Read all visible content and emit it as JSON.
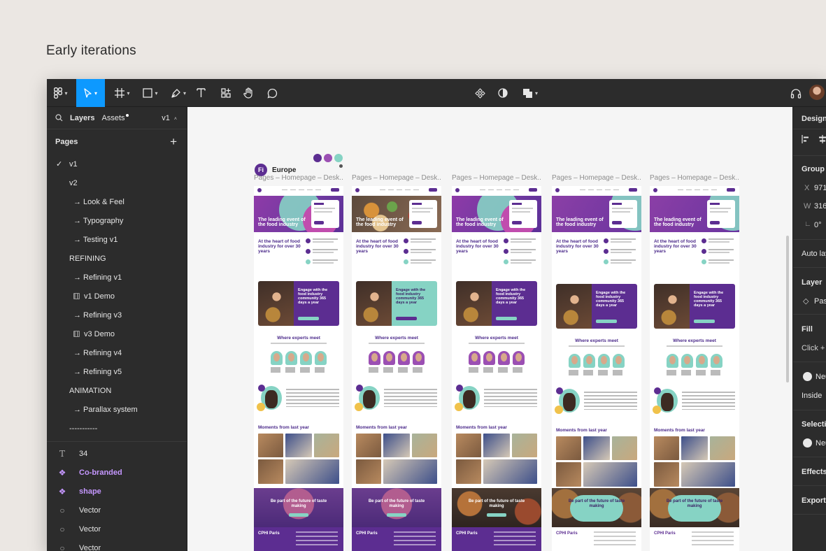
{
  "page_heading": "Early iterations",
  "toolbar": {
    "tools": [
      "main-menu",
      "move",
      "frame",
      "shape",
      "pen",
      "text",
      "resources",
      "hand",
      "comment"
    ],
    "center_tools": [
      "components",
      "mask",
      "boolean"
    ]
  },
  "left_panel": {
    "tabs": {
      "layers": "Layers",
      "assets": "Assets"
    },
    "version": "v1",
    "pages_title": "Pages",
    "pages": [
      {
        "label": "v1",
        "current": true
      },
      {
        "label": "v2"
      },
      {
        "label": "→ Look & Feel"
      },
      {
        "label": "→ Typography"
      },
      {
        "label": "→ Testing v1"
      },
      {
        "label": "REFINING"
      },
      {
        "label": "→ Refining v1"
      },
      {
        "label": "v1 Demo"
      },
      {
        "label": "→ Refining v3"
      },
      {
        "label": "v3 Demo"
      },
      {
        "label": "→ Refining v4"
      },
      {
        "label": "→ Refining v5"
      },
      {
        "label": "ANIMATION"
      },
      {
        "label": "→ Parallax system"
      },
      {
        "label": "-----------"
      }
    ],
    "layers": [
      {
        "label": "34",
        "icon": "text-icon"
      },
      {
        "label": "Co-branded",
        "icon": "component-icon"
      },
      {
        "label": "shape",
        "icon": "component-icon"
      },
      {
        "label": "Vector",
        "icon": "vector-icon"
      },
      {
        "label": "Vector",
        "icon": "vector-icon"
      },
      {
        "label": "Vector",
        "icon": "vector-icon"
      }
    ]
  },
  "canvas": {
    "section_badge": "Fi",
    "section_name": "Europe",
    "frames": [
      {
        "name": "Pages – Homepage – Desk...",
        "hero": "The leading event of the food industry",
        "heart": "At the heart of food industry for over 30 years",
        "engage": "Engage with the food industry community 365 days a year",
        "experts": "Where experts meet",
        "moments": "Moments from last year",
        "cta": "Be part of the future of taste making",
        "footer": "CPHI Paris"
      },
      {
        "name": "Pages – Homepage – Desk...",
        "hero": "The leading event of the food industry",
        "heart": "At the heart of food industry for over 30 years",
        "engage": "Engage with the food industry community 365 days a year",
        "experts": "Where experts meet",
        "moments": "Moments from last year",
        "cta": "Be part of the future of taste making",
        "footer": "CPHI Paris"
      },
      {
        "name": "Pages – Homepage – Desk...",
        "hero": "The leading event of the food industry",
        "heart": "At the heart of food industry for over 30 years",
        "engage": "Engage with the food industry community 365 days a year",
        "experts": "Where experts meet",
        "moments": "Moments from last year",
        "cta": "Be part of the future of taste making",
        "footer": "CPHI Paris"
      },
      {
        "name": "Pages – Homepage – Desk...",
        "hero": "The leading event of the food industry",
        "heart": "At the heart of food industry for over 30 years",
        "engage": "Engage with the food industry community 365 days a year",
        "experts": "Where experts meet",
        "moments": "Moments from last year",
        "cta": "Be part of the future of taste making",
        "footer": "CPHI Paris"
      },
      {
        "name": "Pages – Homepage – Desk...",
        "hero": "The leading event of the food industry",
        "heart": "At the heart of food industry for over 30 years",
        "engage": "Engage with the food industry community 365 days a year",
        "experts": "Where experts meet",
        "moments": "Moments from last year",
        "cta": "Be part of the future of taste making",
        "footer": "CPHI Paris"
      }
    ],
    "palette": [
      "#5c2d91",
      "#9b4fb3",
      "#86d3c4"
    ]
  },
  "right_panel": {
    "tab": "Design",
    "group_title": "Group",
    "x_label": "X",
    "x_value": "971",
    "w_label": "W",
    "w_value": "316",
    "rotation_value": "0°",
    "auto_layout": "Auto layout",
    "layer_title": "Layer",
    "layer_value": "Pass through",
    "fill_title": "Fill",
    "fill_hint": "Click + to replace mixed content",
    "fill_style": "Neutral",
    "stroke_position": "Inside",
    "selection_title": "Selection colors",
    "selection_style": "Neutral",
    "effects_title": "Effects",
    "export_title": "Export"
  },
  "colors": {
    "accent": "#0d99ff",
    "brand_purple": "#5c2d91",
    "brand_mint": "#86d3c4",
    "component": "#c597ff"
  }
}
